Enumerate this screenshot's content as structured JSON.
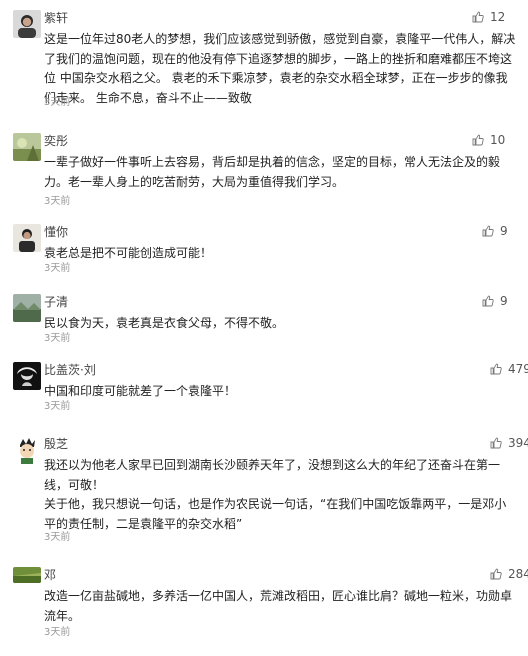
{
  "comments": [
    {
      "user": "紫轩",
      "lines": [
        "这是一位年过80老人的梦想，我们应该感觉到骄傲，感觉到自豪，袁隆平一代伟人，解决了我们的温饱问题，现在的他没有停下追逐梦想的脚步，一路上的挫折和磨难都压不垮这位 中国杂交水稻之父。 袁老的禾下乘凉梦，袁老的杂交水稻全球梦，正在一步步的像我们走来。 生命不息，奋斗不止——致敬"
      ],
      "time": "3天前",
      "likes": "12",
      "avatar_icon": "man-portrait-avatar"
    },
    {
      "user": "奕彤",
      "lines": [
        "一辈子做好一件事听上去容易，背后却是执着的信念，坚定的目标，常人无法企及的毅力。老一辈人身上的吃苦耐劳，大局为重值得我们学习。"
      ],
      "time": "3天前",
      "likes": "10",
      "avatar_icon": "scenery-avatar"
    },
    {
      "user": "懂你",
      "lines": [
        "袁老总是把不可能创造成可能！"
      ],
      "time": "3天前",
      "likes": "9",
      "avatar_icon": "person-avatar"
    },
    {
      "user": "子清",
      "lines": [
        "民以食为天，袁老真是衣食父母，不得不敬。"
      ],
      "time": "3天前",
      "likes": "9",
      "avatar_icon": "landscape-avatar"
    },
    {
      "user": "比盖茨·刘",
      "lines": [
        "中国和印度可能就差了一个袁隆平！"
      ],
      "time": "3天前",
      "likes": "479",
      "avatar_icon": "che-portrait-avatar"
    },
    {
      "user": "殷芝",
      "lines": [
        "我还以为他老人家早已回到湖南长沙颐养天年了，没想到这么大的年纪了还奋斗在第一线，可敬！",
        "关于他，我只想说一句话，也是作为农民说一句话，“在我们中国吃饭靠两平，一是邓小平的责任制，二是袁隆平的杂交水稻”"
      ],
      "time": "3天前",
      "likes": "394",
      "avatar_icon": "cartoon-avatar"
    },
    {
      "user": "邓",
      "lines": [
        "改造一亿亩盐碱地，多养活一亿中国人，荒滩改稻田，匠心谁比肩？碱地一粒米，功勋卓流年。"
      ],
      "time": "3天前",
      "likes": "284",
      "avatar_icon": "rice-field-avatar"
    }
  ]
}
